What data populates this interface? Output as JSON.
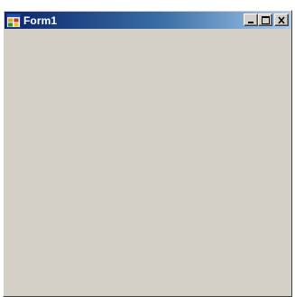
{
  "window": {
    "title": "Form1",
    "icon": "windows-form-icon",
    "caption_buttons": {
      "minimize": "minimize-icon",
      "maximize": "maximize-icon",
      "close": "close-icon"
    }
  },
  "colors": {
    "titlebar_start": "#0a246a",
    "titlebar_end": "#a6caf0",
    "form_background": "#d4d0c8",
    "title_text": "#ffffff"
  }
}
